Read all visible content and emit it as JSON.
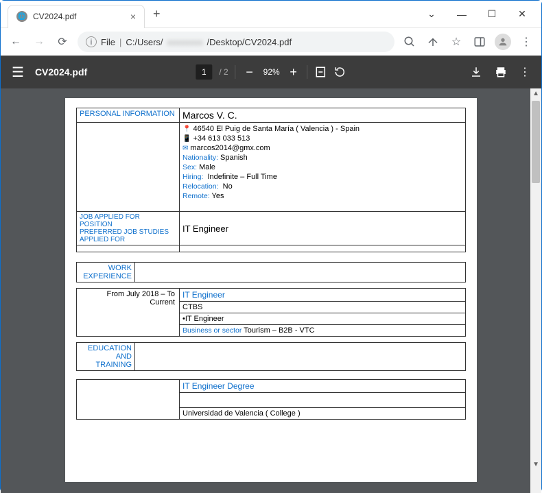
{
  "window": {
    "tab_title": "CV2024.pdf",
    "url_prefix": "File",
    "url_path_start": "C:/Users/",
    "url_path_end": "/Desktop/CV2024.pdf"
  },
  "pdf_toolbar": {
    "title": "CV2024.pdf",
    "page_current": "1",
    "page_total": "/ 2",
    "zoom": "92%"
  },
  "cv": {
    "personal_info_label": "PERSONAL INFORMATION",
    "name": "Marcos V. C.",
    "address": "46540 El Puig de Santa María ( Valencia ) - Spain",
    "phone": "+34 613 033 513",
    "email": "marcos2014@gmx.com",
    "nationality_label": "Nationality:",
    "nationality": "Spanish",
    "sex_label": "Sex:",
    "sex": "Male",
    "hiring_label": "Hiring:",
    "hiring": "Indefinite  – Full Time",
    "relocation_label": "Relocation:",
    "relocation": "No",
    "remote_label": "Remote:",
    "remote": "Yes",
    "job_applied_label": "JOB APPLIED FOR\nPOSITION\nPREFERRED JOB STUDIES APPLIED FOR",
    "job_applied": "IT Engineer",
    "work_exp_label": "WORK EXPERIENCE",
    "work_period": "From July 2018 – To Current",
    "work_title": "IT  Engineer",
    "work_company": "CTBS",
    "work_role": "•IT Engineer",
    "work_sector_label": "Business or sector",
    "work_sector": "Tourism – B2B - VTC",
    "education_label": "EDUCATION AND TRAINING",
    "degree": "IT Engineer Degree",
    "university": "Universidad de Valencia ( College )"
  }
}
